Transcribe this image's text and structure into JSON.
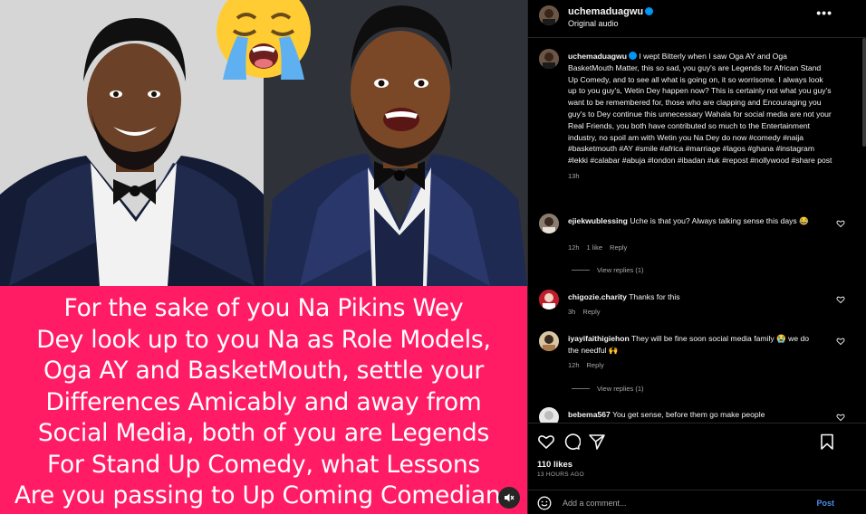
{
  "media": {
    "emoji_icon": "loudly-crying-face-icon",
    "caption_lines": [
      "For the sake of you Na Pikins Wey",
      "Dey look up to you Na as Role Models,",
      "Oga AY and BasketMouth, settle your",
      "Differences Amicably and away from",
      "Social Media, both of you are Legends",
      "For Stand Up Comedy, what Lessons",
      "Are you passing to Up Coming Comedians"
    ],
    "background_color": "#ff1c64",
    "mute_icon": "muted-speaker-icon"
  },
  "header": {
    "username": "uchemaduagwu",
    "subtitle": "Original audio",
    "more_icon": "more-horizontal-icon",
    "more_label": "•••"
  },
  "caption": {
    "username": "uchemaduagwu",
    "text": "I wept Bitterly when I saw Oga AY and Oga BasketMouth Matter, this so sad, you guy's are Legends for African Stand Up Comedy, and to see all what is going on, it so worrisome. I always look up to you guy's, Wetin Dey happen now? This is certainly not what you guy's want to be remembered for, those who are clapping and Encouraging you guy's to Dey continue this unnecessary Wahala for social media are not your Real Friends, you both have contributed so much to the Entertainment industry, no spoil am with Wetin you Na Dey do now #comedy #naija #basketmouth #AY #smile #africa #marriage #lagos #ghana #instagram #lekki #calabar #abuja #london #ibadan #uk #repost #nollywood #share post",
    "time": "13h"
  },
  "comments": [
    {
      "username": "ejiekwublessing",
      "text": "Uche is that you? Always talking sense this days 😂",
      "time": "12h",
      "likes": "1 like",
      "reply": "Reply",
      "view_replies": "View replies (1)"
    },
    {
      "username": "chigozie.charity",
      "text": "Thanks for this",
      "time": "3h",
      "reply": "Reply"
    },
    {
      "username": "iyayifaithigiehon",
      "text": "They will be fine soon social media family 😭 we do the needful 🙌",
      "time": "12h",
      "reply": "Reply",
      "view_replies": "View replies (1)"
    },
    {
      "username": "bebema567",
      "text": "You get sense, before them go make people"
    }
  ],
  "actions": {
    "like_icon": "heart-icon",
    "comment_icon": "comment-icon",
    "share_icon": "send-icon",
    "save_icon": "bookmark-icon",
    "likes": "110 likes",
    "time_ago": "13 HOURS AGO"
  },
  "add_comment": {
    "placeholder": "Add a comment...",
    "post_label": "Post",
    "emoji_icon": "smiley-icon"
  },
  "colors": {
    "accent": "#0095f6",
    "post_button": "#4a8ff0",
    "secondary_text": "#a8a8a8"
  }
}
